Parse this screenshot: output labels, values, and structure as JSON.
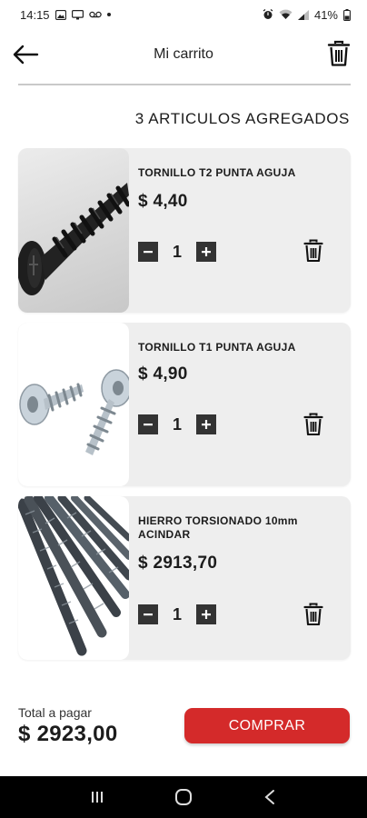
{
  "status_bar": {
    "time": "14:15",
    "battery": "41%"
  },
  "header": {
    "title": "Mi carrito"
  },
  "cart": {
    "count_label": "3 ARTICULOS AGREGADOS",
    "items": [
      {
        "name": "TORNILLO T2 PUNTA AGUJA",
        "price": "$ 4,40",
        "quantity": "1",
        "image": "black-drywall-screw"
      },
      {
        "name": "TORNILLO T1 PUNTA AGUJA",
        "price": "$ 4,90",
        "quantity": "1",
        "image": "silver-wafer-head-screws"
      },
      {
        "name": "HIERRO TORSIONADO 10mm ACINDAR",
        "price": "$ 2913,70",
        "quantity": "1",
        "image": "steel-rebar-bundle"
      }
    ]
  },
  "footer": {
    "total_label": "Total a pagar",
    "total_value": "$ 2923,00",
    "buy_label": "COMPRAR"
  },
  "colors": {
    "accent": "#d42a2a",
    "card_bg": "#eeeeee",
    "qty_button": "#333333",
    "nav_bar": "#000000"
  }
}
